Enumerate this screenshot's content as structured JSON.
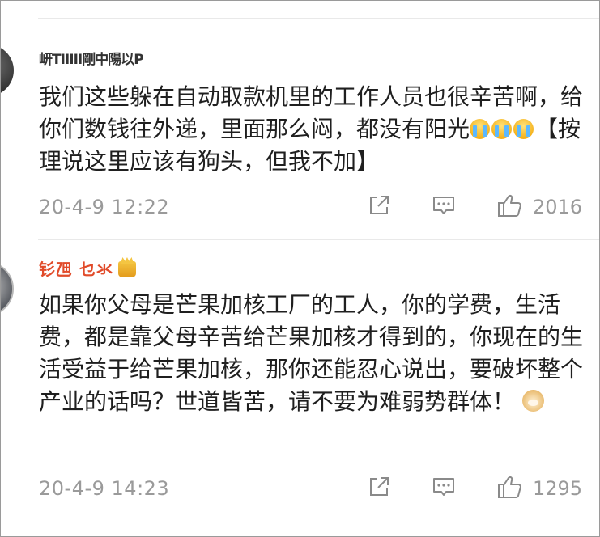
{
  "comments": [
    {
      "username": "岍TIIIII剛中陽以P",
      "text_parts": [
        "我们这些躲在自动取款机里的工作人员也很辛苦啊，给你们数钱往外递，里面那么闷，都没有阳光",
        "【按理说这里应该有狗头，但我不加】"
      ],
      "emojis": [
        "crying-face",
        "crying-face",
        "crying-face"
      ],
      "timestamp": "20-4-9 12:22",
      "likes": "2016"
    },
    {
      "username": "钐乪 乜氺",
      "text_parts": [
        "如果你父母是芒果加核工厂的工人，你的学费，生活费，都是靠父母辛苦给芒果加核才得到的，你现在的生活受益于给芒果加核，那你还能忍心说出，要破坏整个产业的话吗？世道皆苦，请不要为难弱势群体！",
        ""
      ],
      "emojis": [
        "doge-face"
      ],
      "timestamp": "20-4-9 14:23",
      "likes": "1295"
    }
  ],
  "icons": {
    "share": "share-icon",
    "reply": "comment-icon",
    "like": "thumbs-up-icon",
    "crown": "crown-badge-icon"
  },
  "colors": {
    "username_highlight": "#e14b2a",
    "meta": "#9a9a9a",
    "text": "#1f1f1f"
  }
}
